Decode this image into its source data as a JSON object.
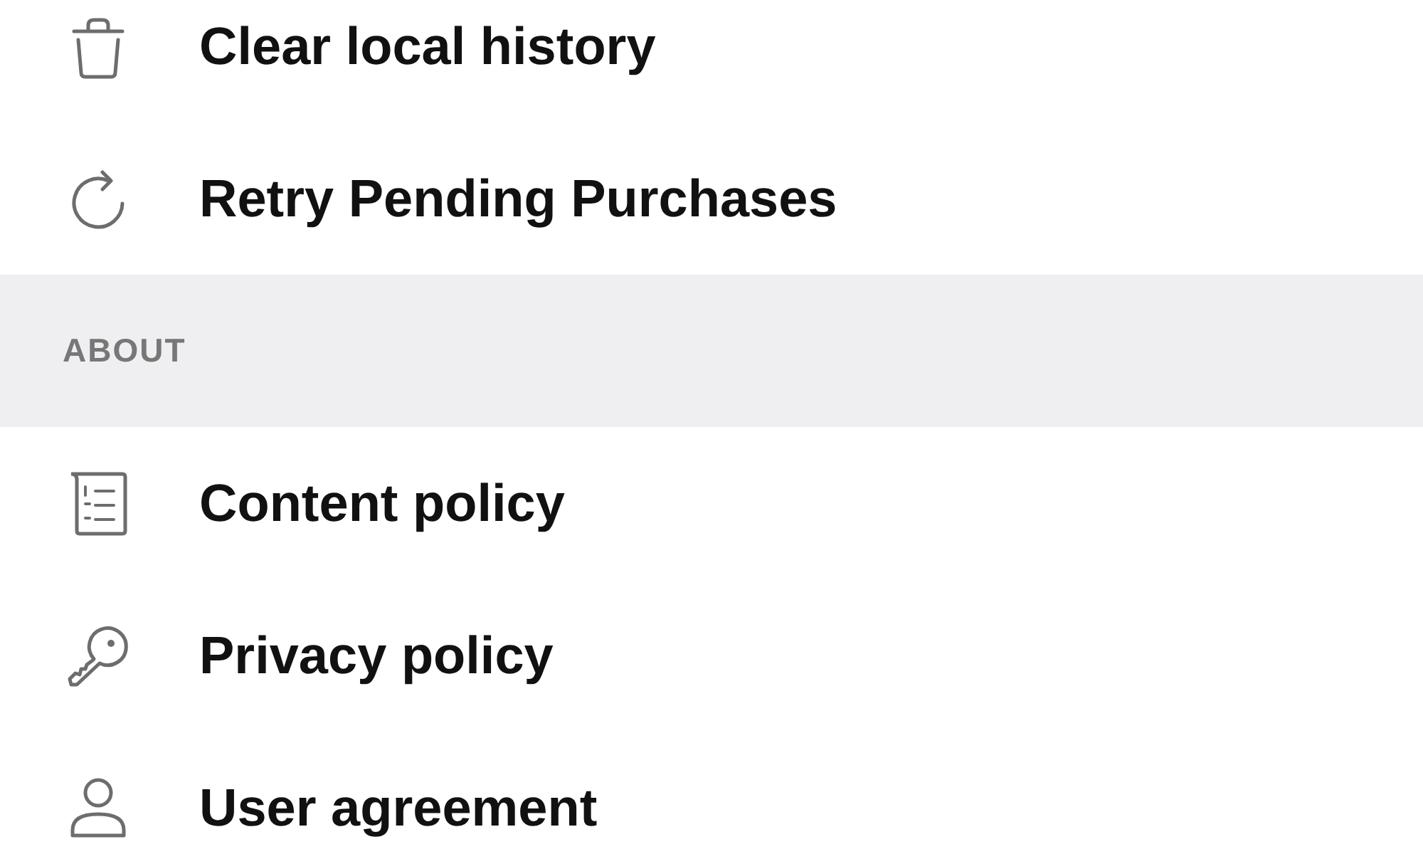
{
  "sections": [
    {
      "items": [
        {
          "label": "Clear local history"
        },
        {
          "label": "Retry Pending Purchases"
        }
      ]
    },
    {
      "header": "ABOUT",
      "items": [
        {
          "label": "Content policy"
        },
        {
          "label": "Privacy policy"
        },
        {
          "label": "User agreement"
        }
      ]
    }
  ]
}
